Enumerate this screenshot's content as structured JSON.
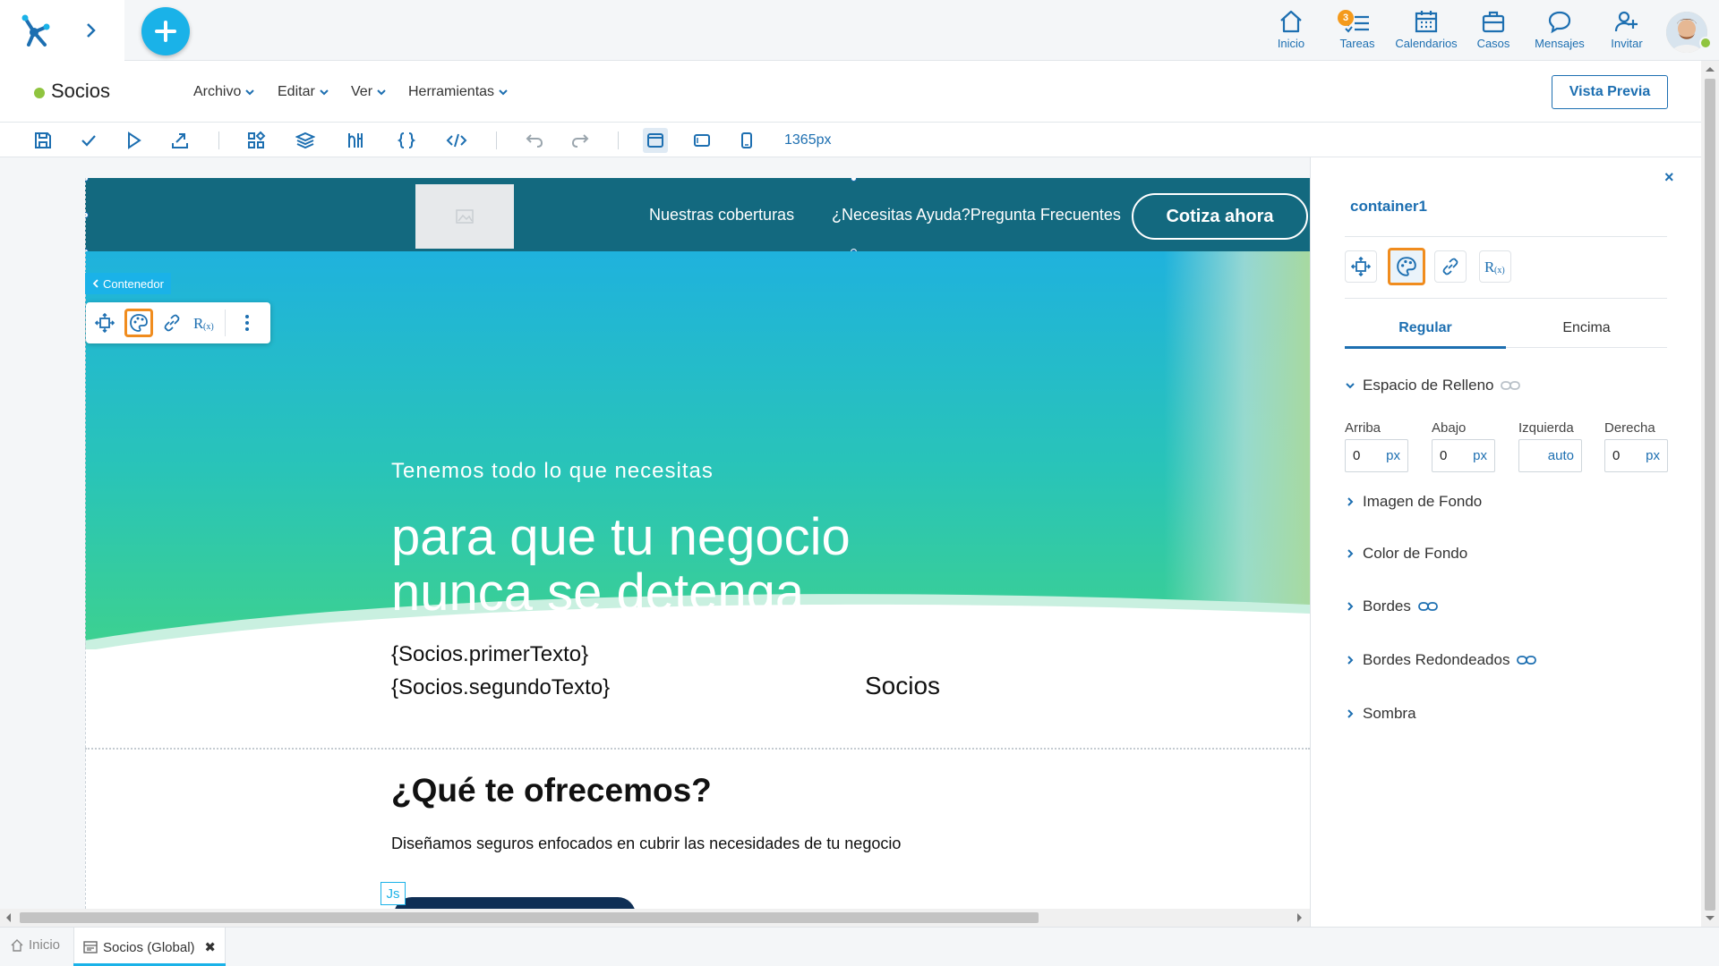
{
  "topnav": {
    "items": [
      {
        "label": "Inicio",
        "icon": "home-icon"
      },
      {
        "label": "Tareas",
        "icon": "tasks-icon",
        "badge": "3"
      },
      {
        "label": "Calendarios",
        "icon": "calendar-icon"
      },
      {
        "label": "Casos",
        "icon": "briefcase-icon"
      },
      {
        "label": "Mensajes",
        "icon": "chat-icon"
      },
      {
        "label": "Invitar",
        "icon": "invite-user-icon"
      }
    ]
  },
  "document": {
    "title": "Socios",
    "status_color": "#8fc43f",
    "menus": [
      "Archivo",
      "Editar",
      "Ver",
      "Herramientas"
    ],
    "preview_label": "Vista Previa"
  },
  "toolbar": {
    "width_label": "1365px"
  },
  "canvas": {
    "nav_links": [
      "Nuestras coberturas",
      "¿Necesitas Ayuda?Pregunta Frecuentes"
    ],
    "cta_label": "Cotiza ahora",
    "container_tag": "Contenedor",
    "hero_subtitle": "Tenemos todo lo que necesitas",
    "hero_title": "para que tu negocio nunca se detenga",
    "bind_text_1": "{Socios.primerTexto}",
    "bind_text_2": "{Socios.segundoTexto}",
    "socios_label": "Socios",
    "offer_title": "¿Qué te ofrecemos?",
    "offer_text": "Diseñamos seguros enfocados en cubrir las necesidades de tu negocio",
    "js_tag": "Js"
  },
  "panel": {
    "close": "×",
    "component_name": "container1",
    "tabs": [
      "Regular",
      "Encima"
    ],
    "padding_section": "Espacio de Relleno",
    "padding_fields": [
      {
        "label": "Arriba",
        "value": "0",
        "unit": "px"
      },
      {
        "label": "Abajo",
        "value": "0",
        "unit": "px"
      },
      {
        "label": "Izquierda",
        "value": "",
        "unit": "auto"
      },
      {
        "label": "Derecha",
        "value": "0",
        "unit": "px"
      }
    ],
    "sections": [
      "Imagen de Fondo",
      "Color de Fondo",
      "Bordes",
      "Bordes Redondeados",
      "Sombra"
    ]
  },
  "bottom_tabs": {
    "home": "Inicio",
    "document": "Socios (Global)",
    "close": "✖"
  },
  "colors": {
    "accent": "#1d6fb1",
    "add_button": "#1ab2e8",
    "highlight": "#f08c1e",
    "site_nav": "#13697f"
  }
}
